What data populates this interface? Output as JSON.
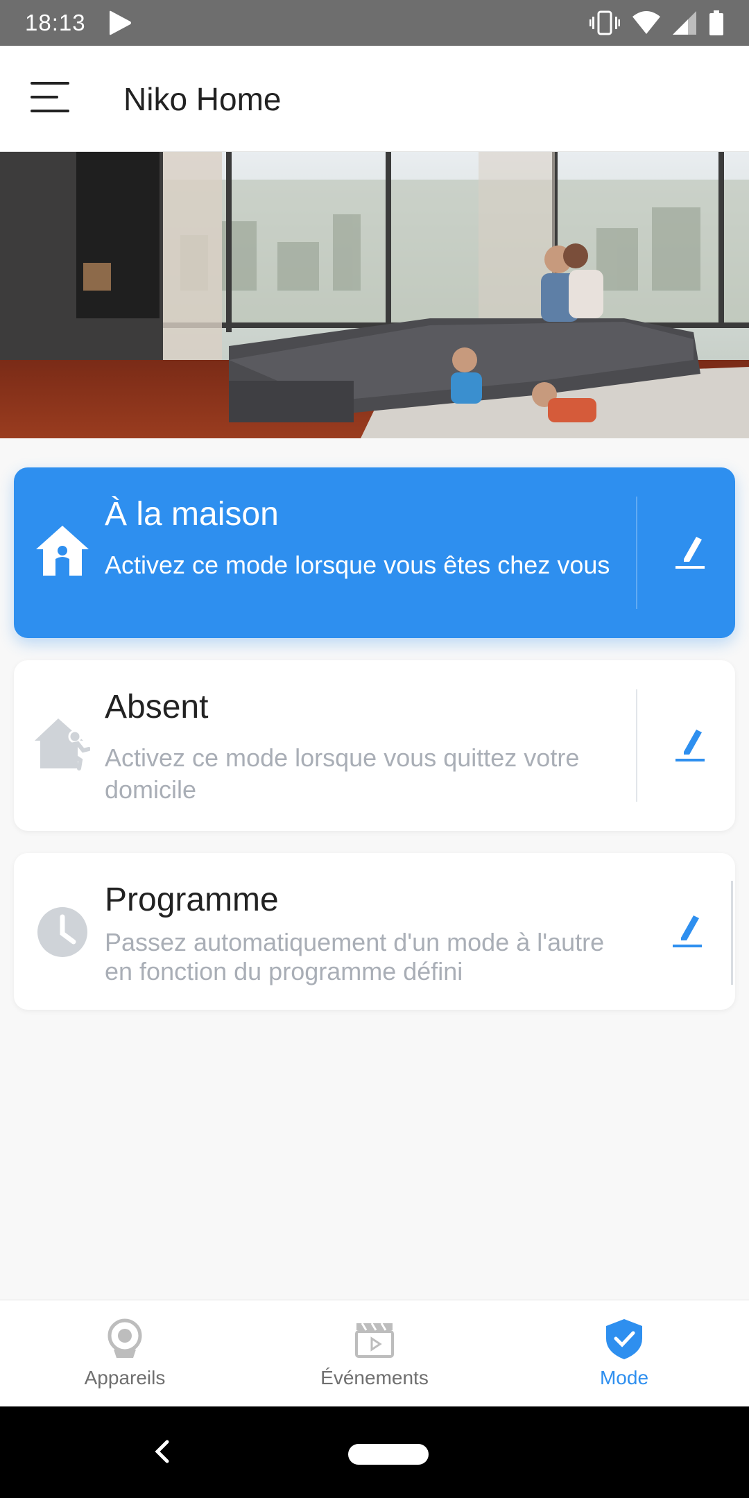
{
  "status_bar": {
    "time": "18:13"
  },
  "app_bar": {
    "title": "Niko Home"
  },
  "modes": [
    {
      "title": "À la maison",
      "description": "Activez ce mode lorsque vous êtes chez vous",
      "icon": "home-person-icon",
      "active": true
    },
    {
      "title": "Absent",
      "description": "Activez ce mode lorsque vous quittez votre domicile",
      "icon": "leaving-home-icon",
      "active": false
    },
    {
      "title": "Programme",
      "description": "Passez automatiquement d'un mode à l'autre en fonction du programme défini",
      "icon": "clock-icon",
      "active": false
    }
  ],
  "bottom_nav": {
    "items": [
      {
        "label": "Appareils",
        "icon": "camera-icon",
        "active": false
      },
      {
        "label": "Événements",
        "icon": "clapperboard-icon",
        "active": false
      },
      {
        "label": "Mode",
        "icon": "shield-check-icon",
        "active": true
      }
    ]
  },
  "colors": {
    "accent": "#2e8fef",
    "status_bar": "#6e6e6e",
    "muted_text": "#a9aeb6",
    "icon_gray": "#cfd3d8"
  }
}
